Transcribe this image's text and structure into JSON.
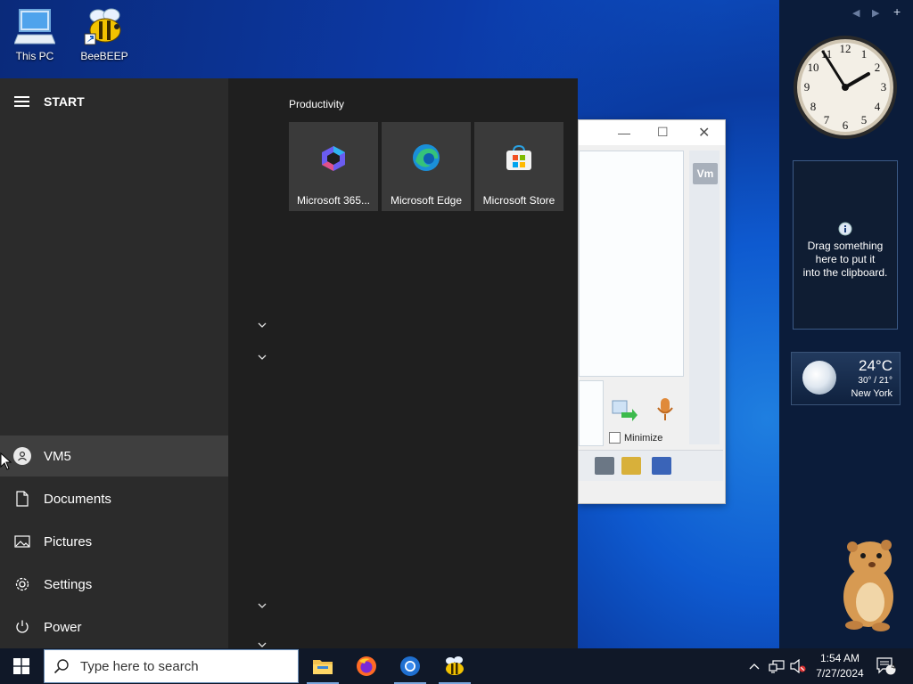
{
  "desktop": {
    "icons": [
      {
        "label": "This PC"
      },
      {
        "label": "BeeBEEP"
      }
    ]
  },
  "background_window": {
    "vm_badge": "Vm",
    "minimize_label": "Minimize",
    "minimize_checked": false
  },
  "start_menu": {
    "title": "START",
    "nav": {
      "user": "VM5",
      "documents": "Documents",
      "pictures": "Pictures",
      "settings": "Settings",
      "power": "Power"
    },
    "group_title": "Productivity",
    "tiles": [
      {
        "label": "Microsoft 365...",
        "icon": "microsoft-365-icon"
      },
      {
        "label": "Microsoft Edge",
        "icon": "edge-icon"
      },
      {
        "label": "Microsoft Store",
        "icon": "store-icon"
      }
    ]
  },
  "gadgets": {
    "clipboard": {
      "message_line1": "Drag something",
      "message_line2": "here to put it",
      "message_line3": "into the clipboard."
    },
    "weather": {
      "temperature": "24°C",
      "range": "30° / 21°",
      "city": "New York"
    }
  },
  "taskbar": {
    "search_placeholder": "Type here to search",
    "apps": [
      "file-explorer-icon",
      "firefox-icon",
      "chrome-icon",
      "beebeep-icon"
    ],
    "time": "1:54 AM",
    "date": "7/27/2024",
    "notification_count": "4"
  },
  "colors": {
    "start_left": "#2b2b2b",
    "start_right": "#1f1f1f",
    "tile": "#3a3a3a",
    "taskbar": "#101828"
  }
}
